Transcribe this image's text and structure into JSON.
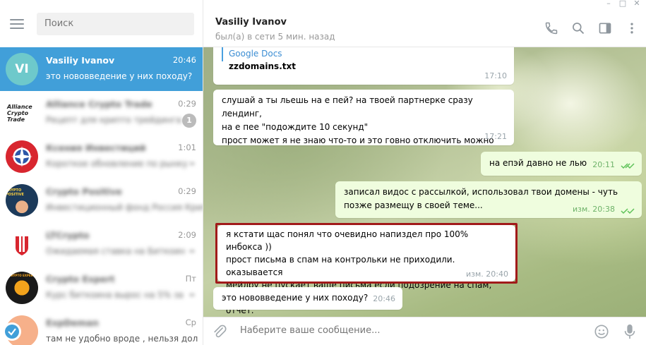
{
  "window": {
    "minimize": "–",
    "maximize": "□",
    "close": "✕"
  },
  "sidebar": {
    "search_placeholder": "Поиск",
    "chats": [
      {
        "name": "Vasiliy Ivanov",
        "time": "20:46",
        "preview": "это нововведение у них походу?",
        "avatar_text": "VI",
        "avatar_color": "#6ec9cb",
        "active": true
      },
      {
        "name": "Alliance Crypto Trade",
        "time": "0:29",
        "preview": "Рецепт для крипто трейдинга ...",
        "avatar_text": "Alliance Crypto Trade",
        "badge": "1"
      },
      {
        "name": "Ксения Инвестиций",
        "time": "1:01",
        "preview": "Короткое обновление по рынку",
        "avatar_color": "#d8262f"
      },
      {
        "name": "Crypto Positive",
        "time": "0:29",
        "preview": "Инвестиционный фонд Россия Криптова",
        "avatar_text": "CRYPTO POSITIVE",
        "avatar_color": "#1c3a5a"
      },
      {
        "name": "LTCrypto",
        "time": "2:09",
        "preview": "Ожидаемая ставка на Биткоин",
        "avatar_color": "#ffffff"
      },
      {
        "name": "Crypto Expert",
        "time": "Пт",
        "preview": "Курс биткоина вырос на 5% за",
        "avatar_text": "CRYPTO EXPERT",
        "avatar_color": "#1a1a1a"
      },
      {
        "name": "ExpDeman",
        "time": "Ср",
        "preview": "там не удобно вроде , нельзя дол",
        "avatar_color": "#f6b08a"
      }
    ]
  },
  "header": {
    "peer_name": "Vasiliy Ivanov",
    "peer_status": "был(а) в сети 5 мин. назад"
  },
  "messages": [
    {
      "id": "m1",
      "dir": "in",
      "link": "Google Docs",
      "text": "zzdomains.txt",
      "time": "17:10"
    },
    {
      "id": "m2",
      "dir": "in",
      "lines": [
        "слушай а ты льешь на е пей? на твоей партнерке сразу лендинг,",
        "на е пее \"подождите 10 секунд\"",
        "прост может я не знаю что-то и это говно отключить можно"
      ],
      "time": "17:21"
    },
    {
      "id": "m3",
      "dir": "out",
      "lines": [
        "на епэй давно не лью"
      ],
      "time": "20:11"
    },
    {
      "id": "m4",
      "dir": "out",
      "lines": [
        "записал видос с рассылкой, использовал твои домены - чуть",
        "позже размещу в своей теме..."
      ],
      "time": "изм. 20:38"
    },
    {
      "id": "m5",
      "dir": "in",
      "lines": [
        "я кстати щас понял что очевидно напиздел про 100% инбокса ))",
        "прост письма в спам на контрольки не приходили. оказывается",
        "мейлру не пускает ваще письма  если подозрение на спам, шлет",
        "отчет."
      ],
      "time": "изм. 20:40"
    },
    {
      "id": "m6",
      "dir": "in",
      "lines": [
        "это нововведение у них походу?"
      ],
      "time": "20:46"
    }
  ],
  "composer": {
    "placeholder": "Наберите ваше сообщение..."
  },
  "colors": {
    "accent": "#419fd9",
    "outgoing_bubble": "#effdde",
    "highlight_border": "#a11a1a",
    "check_color": "#5ec259"
  }
}
